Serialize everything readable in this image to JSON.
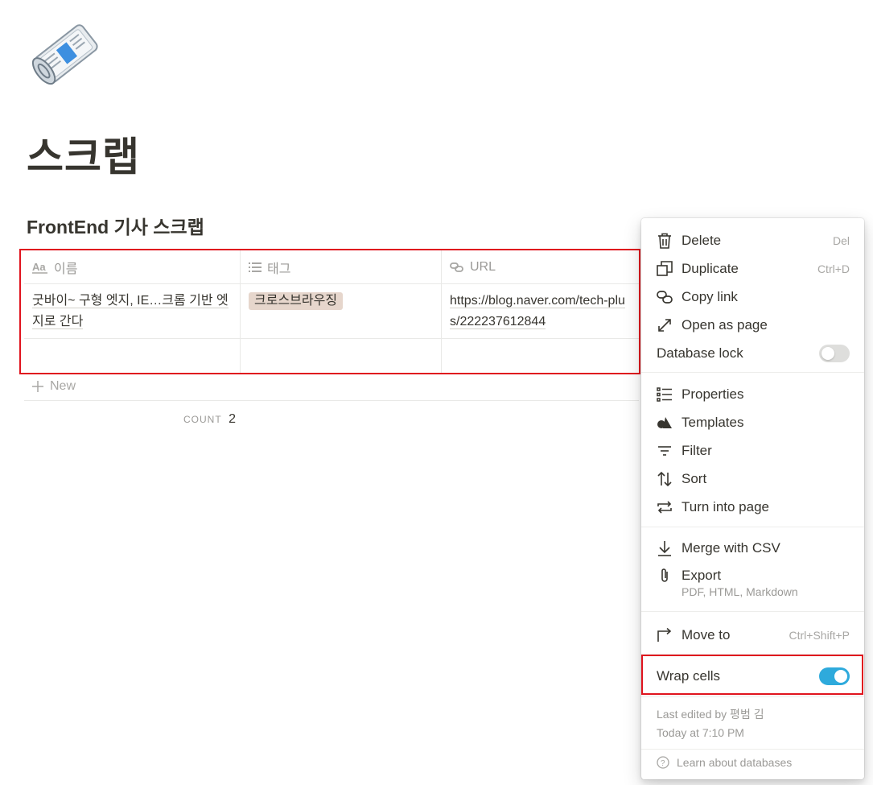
{
  "page": {
    "title": "스크랩",
    "icon": "newspaper-roll-icon"
  },
  "database": {
    "title": "FrontEnd 기사 스크랩",
    "columns": [
      {
        "label": "이름",
        "icon": "text-aa-icon"
      },
      {
        "label": "태그",
        "icon": "list-icon"
      },
      {
        "label": "URL",
        "icon": "link-icon"
      }
    ],
    "rows": [
      {
        "name": "굿바이~ 구형 엣지, IE…크롬 기반 엣지로 간다",
        "tag": "크로스브라우징",
        "url": "https://blog.naver.com/tech-plus/222237612844"
      }
    ],
    "new_label": "New",
    "count_label": "COUNT",
    "count_value": "2"
  },
  "menu": {
    "delete": {
      "label": "Delete",
      "shortcut": "Del"
    },
    "duplicate": {
      "label": "Duplicate",
      "shortcut": "Ctrl+D"
    },
    "copy_link": {
      "label": "Copy link"
    },
    "open_as_page": {
      "label": "Open as page"
    },
    "database_lock": {
      "label": "Database lock",
      "enabled": false
    },
    "properties": {
      "label": "Properties"
    },
    "templates": {
      "label": "Templates"
    },
    "filter": {
      "label": "Filter"
    },
    "sort": {
      "label": "Sort"
    },
    "turn_into_page": {
      "label": "Turn into page"
    },
    "merge_csv": {
      "label": "Merge with CSV"
    },
    "export": {
      "label": "Export",
      "sub": "PDF, HTML, Markdown"
    },
    "move_to": {
      "label": "Move to",
      "shortcut": "Ctrl+Shift+P"
    },
    "wrap_cells": {
      "label": "Wrap cells",
      "enabled": true
    },
    "last_edited": "Last edited by 평범 김",
    "edited_time": "Today at 7:10 PM",
    "learn": "Learn about databases"
  },
  "colors": {
    "highlight": "#e0141e",
    "toggle_on": "#2eaadc",
    "tag_bg": "#e6d6cc"
  }
}
